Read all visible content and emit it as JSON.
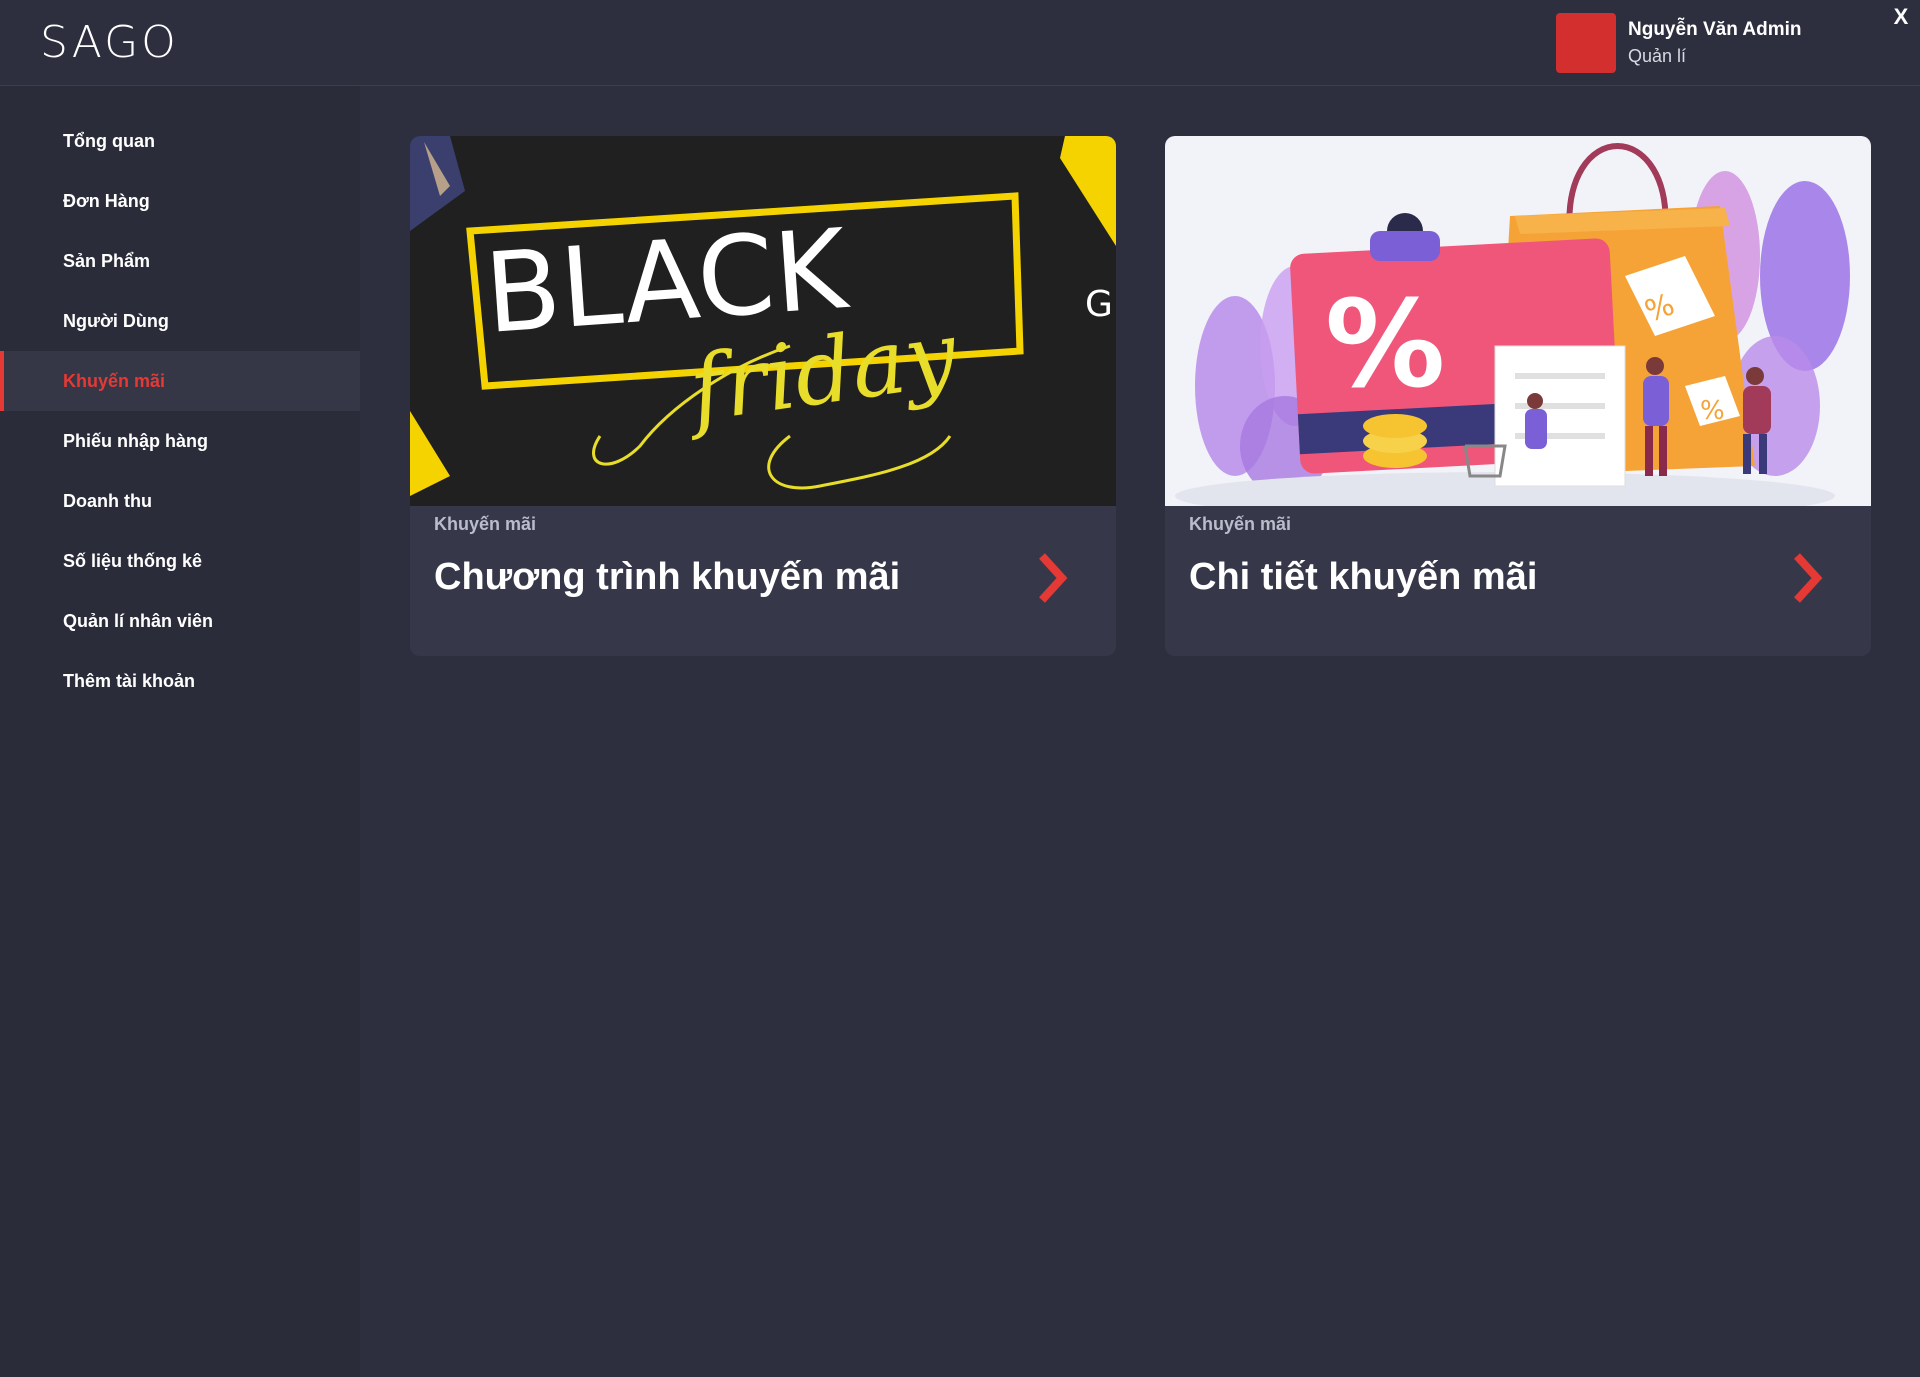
{
  "header": {
    "logo": "SAGO",
    "user_name": "Nguyễn Văn Admin",
    "user_role": "Quản lí",
    "close_label": "X",
    "avatar_color": "#d32f2f"
  },
  "sidebar": {
    "items": [
      {
        "label": "Tổng quan"
      },
      {
        "label": "Đơn Hàng"
      },
      {
        "label": "Sản Phẩm"
      },
      {
        "label": "Người Dùng"
      },
      {
        "label": "Khuyến mãi",
        "active": true
      },
      {
        "label": "Phiếu nhập hàng"
      },
      {
        "label": "Doanh thu"
      },
      {
        "label": "Số liệu thống kê"
      },
      {
        "label": "Quản lí nhân viên"
      },
      {
        "label": "Thêm tài khoản"
      }
    ]
  },
  "cards": [
    {
      "category": "Khuyến mãi",
      "title": "Chương trình khuyến mãi",
      "banner_word": "BLACK",
      "banner_script": "friday",
      "banner_partial": "G"
    },
    {
      "category": "Khuyến mãi",
      "title": "Chi tiết khuyến mãi",
      "badge": "%"
    }
  ],
  "colors": {
    "accent": "#e53935",
    "background": "#2d2f3e",
    "card": "#363849",
    "banner_yellow": "#f5d300"
  }
}
